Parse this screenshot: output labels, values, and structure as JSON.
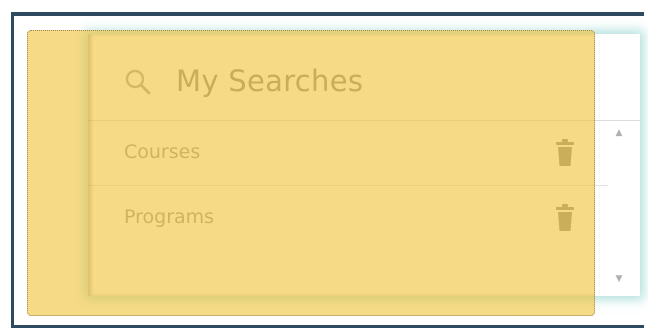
{
  "panel": {
    "title": "My Searches",
    "title_icon": "search-icon",
    "items": [
      {
        "label": "Courses",
        "action_icon": "trash-icon"
      },
      {
        "label": "Programs",
        "action_icon": "trash-icon"
      }
    ]
  },
  "scrollbar": {
    "up_glyph": "▲",
    "down_glyph": "▼"
  },
  "colors": {
    "highlight": "#f0c43c",
    "frame_border": "#2e4a5e",
    "text": "#9a9a9a",
    "glow": "#78c8c3"
  }
}
